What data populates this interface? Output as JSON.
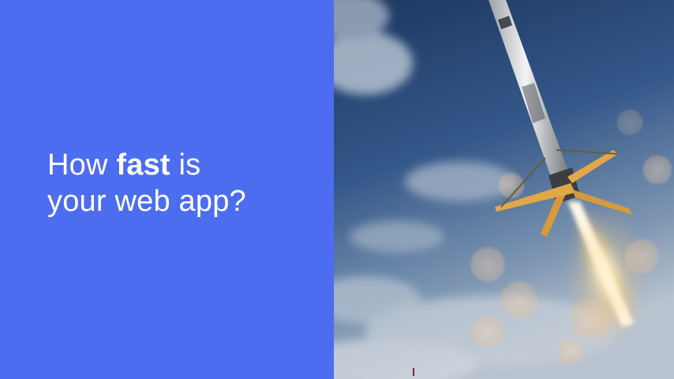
{
  "headline": {
    "line1_pre": "How ",
    "line1_bold": "fast",
    "line1_post": " is",
    "line2": "your web app?"
  },
  "colors": {
    "left_panel": "#4d6df0",
    "headline_text": "#ffffff",
    "sky_top": "#1f3b63",
    "sky_bottom": "#a9b8c9"
  },
  "photo": {
    "subject": "rocket-landing-photo"
  }
}
